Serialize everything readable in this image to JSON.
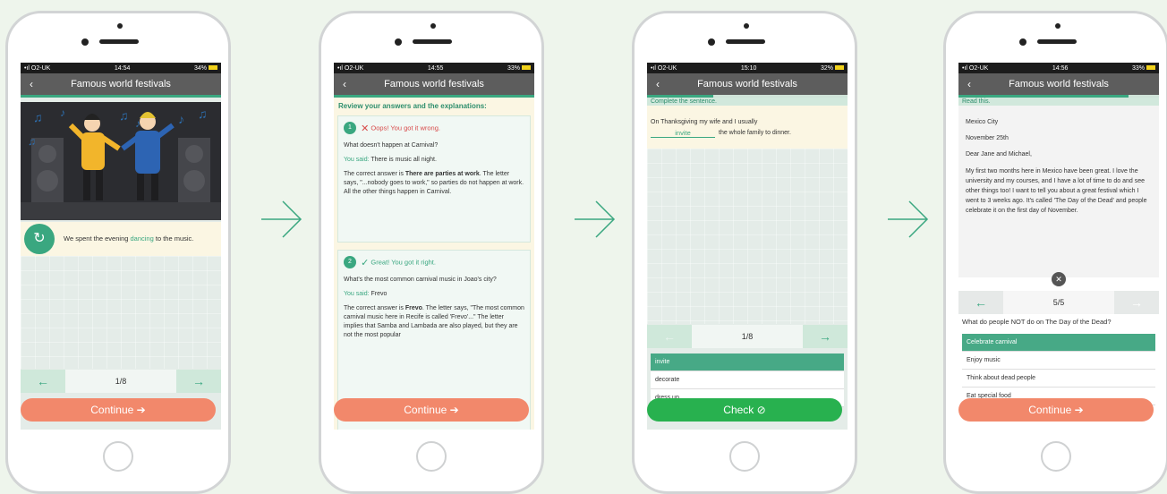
{
  "status": {
    "carrier": "O2-UK",
    "times": [
      "14:54",
      "14:55",
      "15:10",
      "14:56"
    ],
    "batteries": [
      "34%",
      "33%",
      "32%",
      "33%"
    ]
  },
  "nav": {
    "title": "Famous world festivals",
    "back_icon": "back-chevron-icon"
  },
  "colors": {
    "accent": "#3aa780",
    "continue": "#f2886b",
    "check": "#28b14f",
    "nav": "#5d5d5d",
    "background": "#eef5ec"
  },
  "screen1": {
    "sentence_before": "We spent the evening ",
    "sentence_highlight": "dancing",
    "sentence_after": " to the music.",
    "pager": "1/8",
    "continue_label": "Continue"
  },
  "screen2": {
    "header": "Review your answers and the explanations:",
    "item1": {
      "num": "1",
      "result": "Oops! You got it wrong.",
      "question": "What doesn't happen at Carnival?",
      "you_said_label": "You said:",
      "you_said": "There is music all night.",
      "expl_before": "The correct answer is ",
      "expl_answer": "There are parties at work",
      "expl_after": ". The letter says, \"...nobody goes to work,\" so parties do not happen at work. All the other things happen in Carnival."
    },
    "item2": {
      "num": "2",
      "result": "Great! You got it right.",
      "question": "What's the most common carnival music in Joao's city?",
      "you_said_label": "You said:",
      "you_said": "Frevo",
      "expl_before": "The correct answer is ",
      "expl_answer": "Frevo",
      "expl_after": ". The letter says, \"The most common carnival music here in Recife is called 'Frevo'...\" The letter implies that Samba and Lambada are also played, but they are not the most popular"
    },
    "continue_label": "Continue"
  },
  "screen3": {
    "instruction": "Complete the sentence.",
    "sentence_before": "On Thanksgiving my wife and I usually",
    "answer": "invite",
    "sentence_after": "the whole family to dinner.",
    "pager": "1/8",
    "options": [
      "invite",
      "decorate",
      "dress up"
    ],
    "check_label": "Check"
  },
  "screen4": {
    "instruction": "Read this.",
    "letter": {
      "place": "Mexico City",
      "date": "November 25th",
      "greeting": "Dear Jane and Michael,",
      "body": "My first two months here in Mexico have been great. I love the university and my courses, and I have a lot of time to do and see other things too! I want to tell you about a great festival which I went to 3 weeks ago. It's called 'The Day of the Dead' and people celebrate it on the first day of November."
    },
    "pager": "5/5",
    "question": "What do people NOT do on The Day of the Dead?",
    "options": [
      "Celebrate carnival",
      "Enjoy music",
      "Think about dead people",
      "Eat special food"
    ],
    "continue_label": "Continue"
  }
}
